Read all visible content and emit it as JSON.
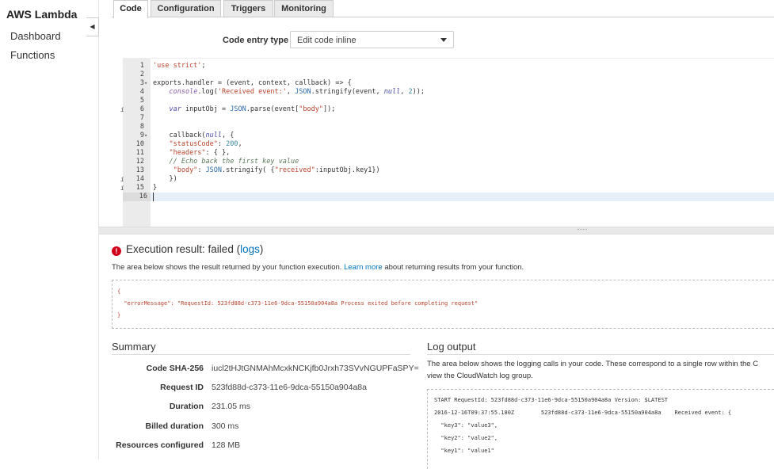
{
  "sidebar": {
    "brand": "AWS Lambda",
    "items": [
      {
        "label": "Dashboard"
      },
      {
        "label": "Functions"
      }
    ],
    "collapse_glyph": "◀"
  },
  "tabs": [
    {
      "label": "Code",
      "active": true
    },
    {
      "label": "Configuration",
      "active": false
    },
    {
      "label": "Triggers",
      "active": false
    },
    {
      "label": "Monitoring",
      "active": false
    }
  ],
  "code_entry": {
    "label": "Code entry type",
    "value": "Edit code inline"
  },
  "editor": {
    "lines": [
      {
        "n": "1",
        "text": "'use strict';"
      },
      {
        "n": "2",
        "text": ""
      },
      {
        "n": "3",
        "text": "exports.handler = (event, context, callback) => {",
        "fold": true
      },
      {
        "n": "4",
        "text": "    console.log('Received event:', JSON.stringify(event, null, 2));"
      },
      {
        "n": "5",
        "text": ""
      },
      {
        "n": "6",
        "text": "    var inputObj = JSON.parse(event[\"body\"]);",
        "info": true
      },
      {
        "n": "7",
        "text": ""
      },
      {
        "n": "8",
        "text": ""
      },
      {
        "n": "9",
        "text": "    callback(null, {",
        "fold": true
      },
      {
        "n": "10",
        "text": "    \"statusCode\": 200,"
      },
      {
        "n": "11",
        "text": "    \"headers\": { },"
      },
      {
        "n": "12",
        "text": "    // Echo back the first key value"
      },
      {
        "n": "13",
        "text": "     \"body\": JSON.stringify( {\"received\":inputObj.key1})"
      },
      {
        "n": "14",
        "text": "    })",
        "info": true
      },
      {
        "n": "15",
        "text": "}",
        "info": true
      },
      {
        "n": "16",
        "text": "",
        "current": true
      }
    ]
  },
  "execution": {
    "title_prefix": "Execution result: failed (",
    "title_link": "logs",
    "title_suffix": ")",
    "desc_prefix": "The area below shows the result returned by your function execution. ",
    "desc_link": "Learn more",
    "desc_suffix": " about returning results from your function.",
    "result_lines": [
      "{",
      "  \"errorMessage\": \"RequestId: 523fd88d-c373-11e6-9dca-55150a904a8a Process exited before completing request\"",
      "}"
    ]
  },
  "summary": {
    "title": "Summary",
    "rows": [
      {
        "key": "Code SHA-256",
        "value": "iucl2tHJtGNMAhMcxkNCKjfb0Jrxh73SVvNGUPFaSPY="
      },
      {
        "key": "Request ID",
        "value": "523fd88d-c373-11e6-9dca-55150a904a8a"
      },
      {
        "key": "Duration",
        "value": "231.05 ms"
      },
      {
        "key": "Billed duration",
        "value": "300 ms"
      },
      {
        "key": "Resources configured",
        "value": "128 MB"
      }
    ]
  },
  "log_output": {
    "title": "Log output",
    "desc_line1": "The area below shows the logging calls in your code. These correspond to a single row within the C",
    "desc_line2": "view the CloudWatch log group.",
    "lines": [
      "START RequestId: 523fd88d-c373-11e6-9dca-55150a904a8a Version: $LATEST",
      "2016-12-16T09:37:55.180Z\t523fd88d-c373-11e6-9dca-55150a904a8a\tReceived event: {",
      "  \"key3\": \"value3\",",
      "  \"key2\": \"value2\",",
      "  \"key1\": \"value1\""
    ]
  },
  "colors": {
    "link": "#0073bb",
    "error": "#d0021b",
    "string": "#b8432c"
  }
}
